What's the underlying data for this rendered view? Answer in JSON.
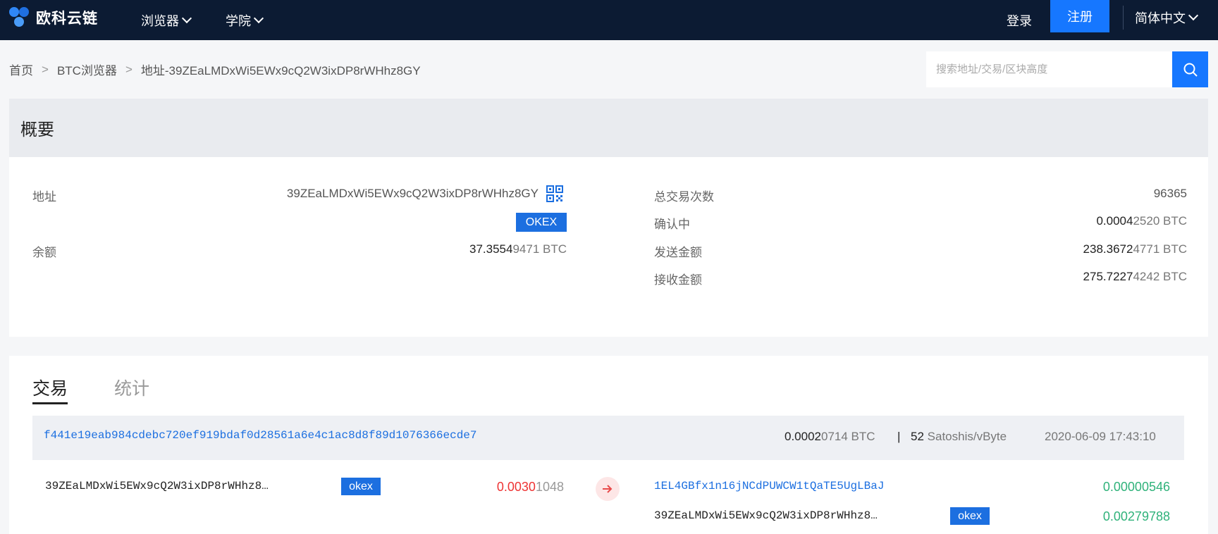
{
  "brand": {
    "name": "欧科云链"
  },
  "nav": {
    "browser": "浏览器",
    "academy": "学院",
    "login": "登录",
    "register": "注册",
    "language": "简体中文"
  },
  "breadcrumb": {
    "home": "首页",
    "explorer": "BTC浏览器",
    "current": "地址-39ZEaLMDxWi5EWx9cQ2W3ixDP8rWHhz8GY"
  },
  "search": {
    "placeholder": "搜索地址/交易/区块高度"
  },
  "summary": {
    "title": "概要",
    "address_label": "地址",
    "address_value": "39ZEaLMDxWi5EWx9cQ2W3ixDP8rWHhz8GY",
    "address_tag": "OKEX",
    "balance_label": "余额",
    "balance_main": "37.3554",
    "balance_rest": "9471 BTC",
    "total_tx_label": "总交易次数",
    "total_tx_value": "96365",
    "pending_label": "确认中",
    "pending_main": "0.0004",
    "pending_rest": "2520 BTC",
    "sent_label": "发送金额",
    "sent_main": "238.3672",
    "sent_rest": "4771 BTC",
    "received_label": "接收金额",
    "received_main": "275.7227",
    "received_rest": "4242 BTC"
  },
  "tabs": {
    "transactions": "交易",
    "stats": "统计"
  },
  "tx": {
    "hash": "f441e19eab984cdebc720ef919bdaf0d28561a6e4c1ac8d8f89d1076366ecde7",
    "fee_main": "0.0002",
    "fee_rest": "0714 BTC",
    "separator": "|",
    "rate_main": "52",
    "rate_rest": "Satoshis/vByte",
    "time": "2020-06-09 17:43:10",
    "input": {
      "address": "39ZEaLMDxWi5EWx9cQ2W3ixDP8rWHhz8…",
      "tag": "okex",
      "amount_main": "0.0030",
      "amount_rest": "1048"
    },
    "outputs": [
      {
        "address": "1EL4GBfx1n16jNCdPUWCW1tQaTE5UgLBaJ",
        "amount": "0.00000546"
      },
      {
        "address": "39ZEaLMDxWi5EWx9cQ2W3ixDP8rWHhz8…",
        "tag": "okex",
        "amount": "0.00279788"
      }
    ]
  },
  "colors": {
    "topbar": "#0c1b33",
    "accent": "#1677ff",
    "negative": "#e33333",
    "positive": "#2fb27a"
  }
}
